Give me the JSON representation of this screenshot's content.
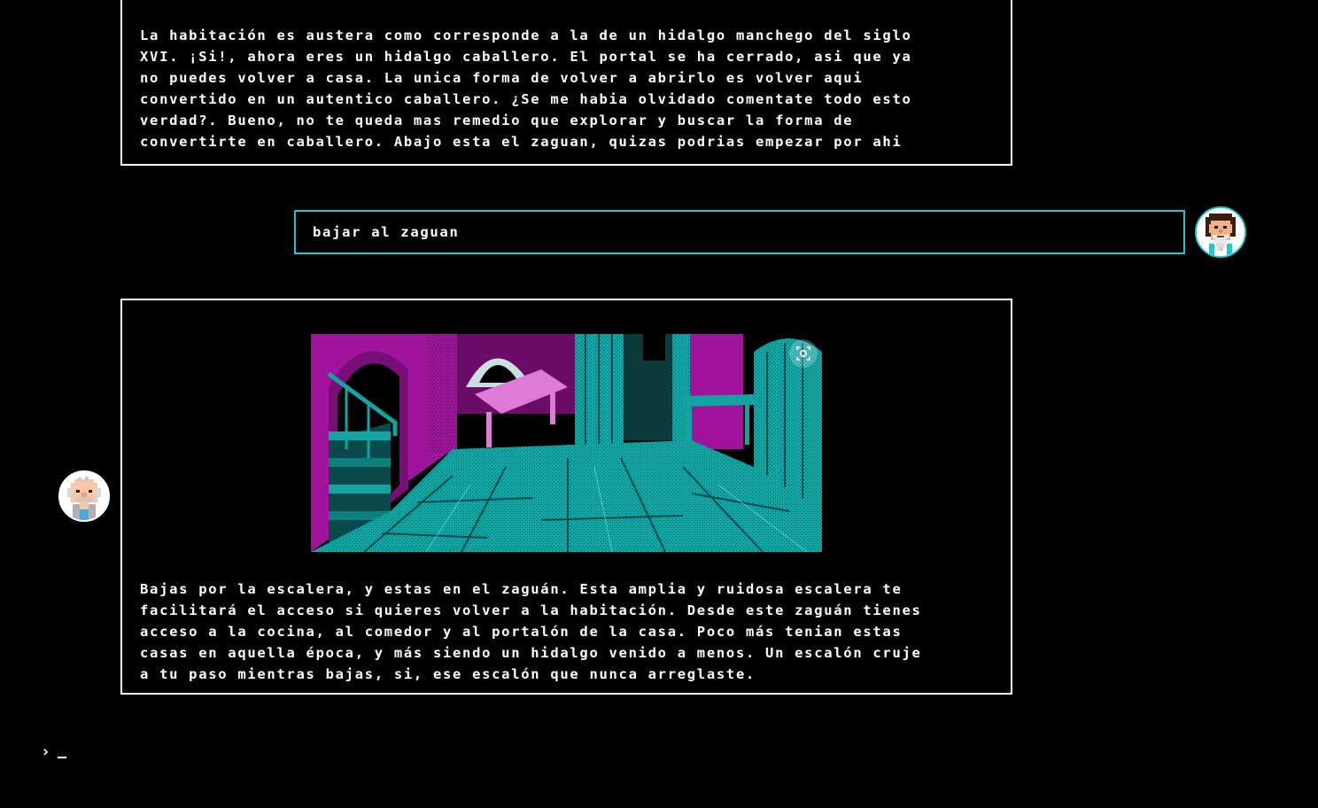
{
  "messages": {
    "narrator_1": "La habitación es austera como corresponde a la de un hidalgo manchego del siglo\nXVI. ¡Si!, ahora eres un hidalgo caballero. El portal se ha cerrado, asi que ya\nno puedes volver a casa. La unica forma de volver a abrirlo es volver aqui\nconvertido en un autentico caballero. ¿Se me habia olvidado comentate todo esto\nverdad?. Bueno, no te queda mas remedio que explorar y buscar la forma de\nconvertirte en caballero. Abajo esta el zaguan, quizas podrias empezar por ahi",
    "user_command": "bajar al zaguan",
    "narrator_2": "Bajas por la escalera, y estas en el zaguán. Esta amplia y ruidosa escalera te\nfacilitará el acceso si quieres volver a la habitación. Desde este zaguán tienes\nacceso a la cocina, al comedor y al portalón de la casa. Poco más tenian estas\ncasas en aquella época, y más siendo un hidalgo venido a menos. Un escalón cruje\na tu paso mientras bajas, si, ese escalón que nunca arreglaste."
  },
  "prompt": {
    "symbol": "›"
  },
  "colors": {
    "background": "#000000",
    "text": "#ffffff",
    "user_accent": "#22c4d2",
    "scene_magenta": "#a0149c",
    "scene_teal": "#12a3a3"
  },
  "icons": {
    "user_avatar": "bearded-man-avatar-icon",
    "narrator_avatar": "old-man-avatar-icon",
    "image_zoom": "lens-icon"
  }
}
